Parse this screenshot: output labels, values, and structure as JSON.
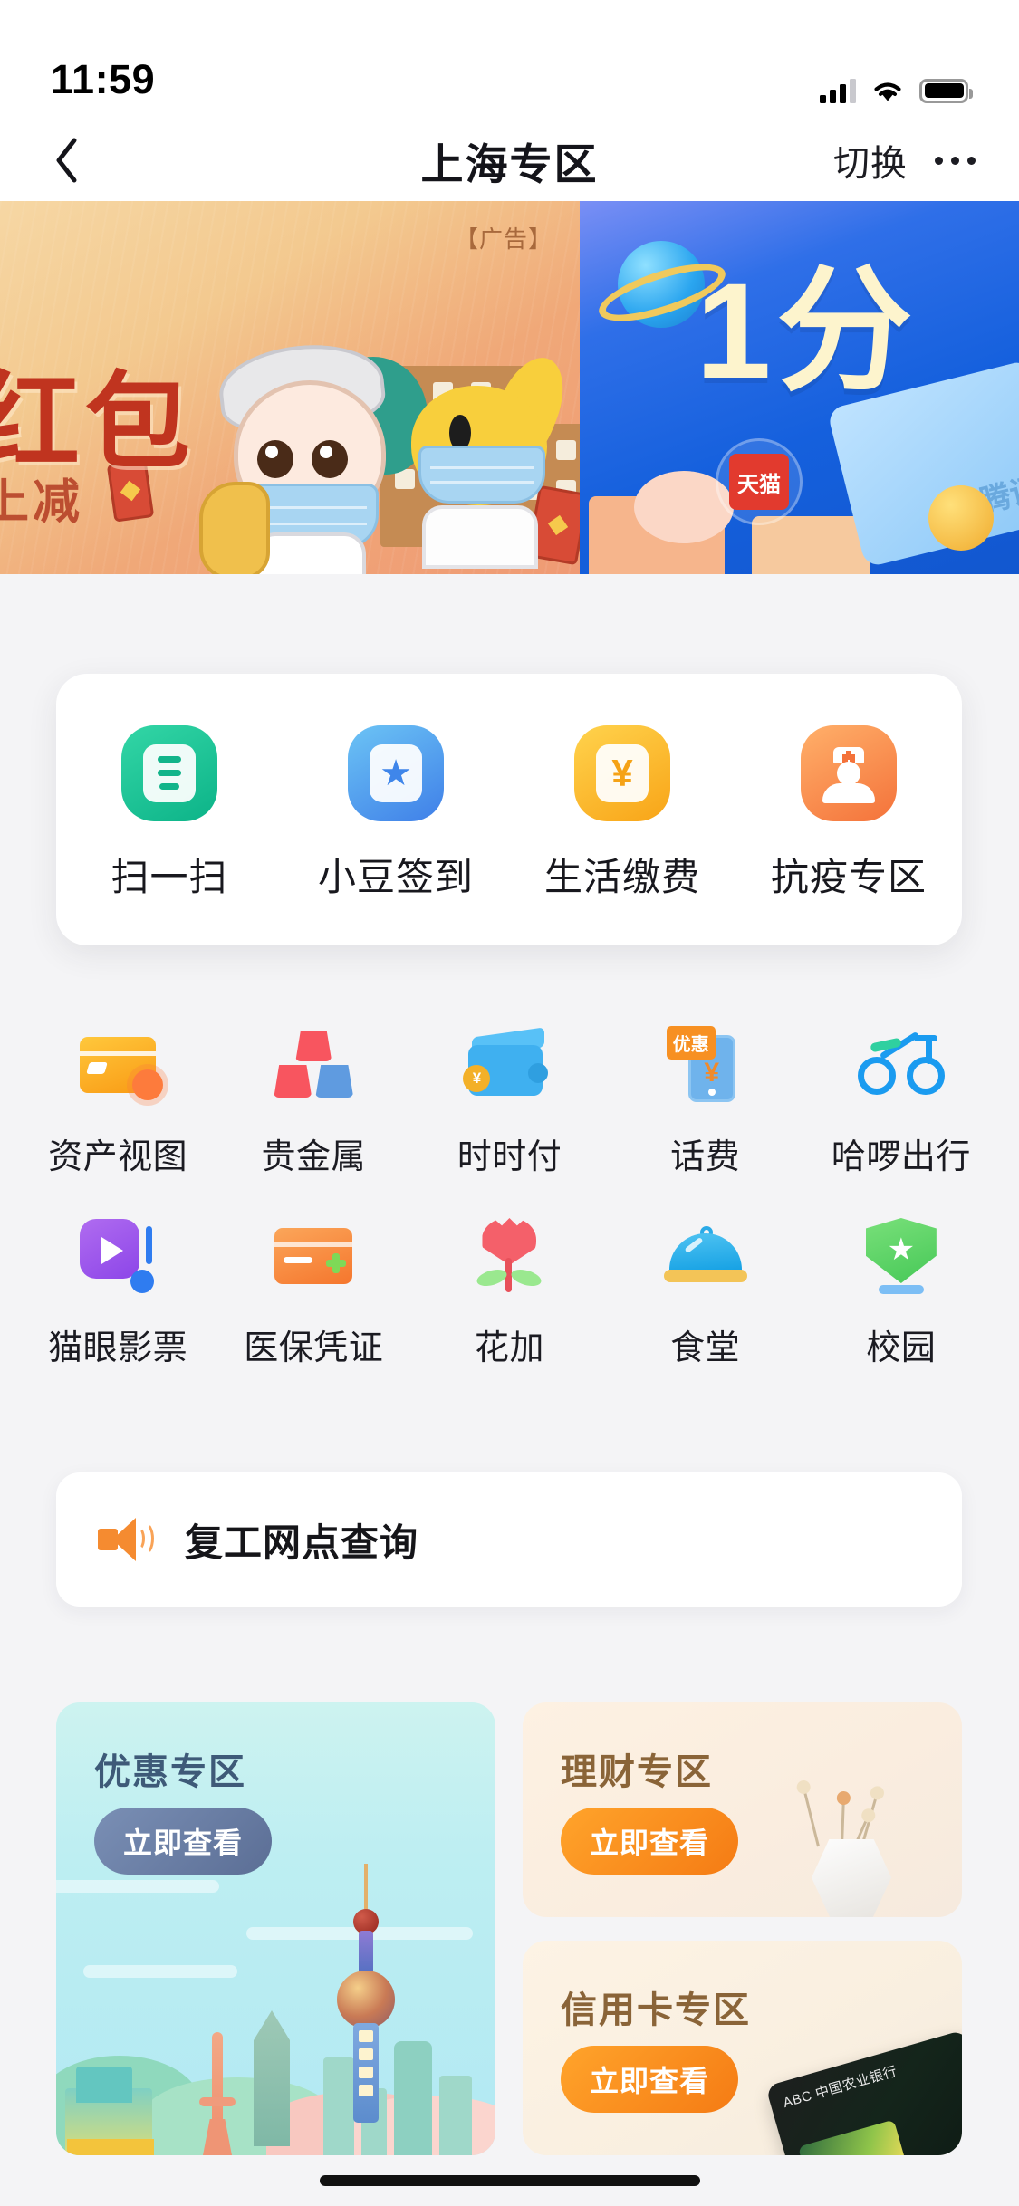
{
  "status_bar": {
    "time": "11:59",
    "signal_icon": "cellular-signal-icon",
    "wifi_icon": "wifi-icon",
    "battery_icon": "battery-icon"
  },
  "nav_bar": {
    "back_icon": "chevron-left-icon",
    "title": "上海专区",
    "switch_label": "切换",
    "more_icon": "more-dots-icon"
  },
  "banner": {
    "left": {
      "ad_tag": "【广告】",
      "headline": "红包",
      "subline": "上减",
      "mascot_icons": [
        "masked-mascot-icon",
        "masked-dog-mascot-icon"
      ]
    },
    "right": {
      "headline": "1分",
      "brand_badge": "天猫",
      "partner_label": "腾讯",
      "planet_icon": "planet-icon"
    }
  },
  "quick_actions": [
    {
      "label": "扫一扫",
      "icon": "scan-code-icon",
      "color": "#0cb388"
    },
    {
      "label": "小豆签到",
      "icon": "star-checkin-icon",
      "color": "#3f7fe8"
    },
    {
      "label": "生活缴费",
      "icon": "yen-payment-icon",
      "color": "#f8a417"
    },
    {
      "label": "抗疫专区",
      "icon": "nurse-epidemic-icon",
      "color": "#f4723a"
    }
  ],
  "icon_grid": {
    "row1": [
      {
        "label": "资产视图",
        "icon": "asset-card-icon"
      },
      {
        "label": "贵金属",
        "icon": "gold-bars-icon"
      },
      {
        "label": "时时付",
        "icon": "wallet-icon"
      },
      {
        "label": "话费",
        "icon": "mobile-topup-icon",
        "badge": "优惠"
      },
      {
        "label": "哈啰出行",
        "icon": "bicycle-icon"
      }
    ],
    "row2": [
      {
        "label": "猫眼影票",
        "icon": "movie-ticket-icon"
      },
      {
        "label": "医保凭证",
        "icon": "medical-insurance-card-icon"
      },
      {
        "label": "花加",
        "icon": "tulip-flower-icon"
      },
      {
        "label": "食堂",
        "icon": "food-cloche-icon"
      },
      {
        "label": "校园",
        "icon": "campus-shield-icon"
      }
    ]
  },
  "notice": {
    "icon": "megaphone-icon",
    "text": "复工网点查询"
  },
  "promos": [
    {
      "title": "优惠专区",
      "button": "立即查看",
      "theme": "cyan",
      "art": "shanghai-skyline-art"
    },
    {
      "title": "理财专区",
      "button": "立即查看",
      "theme": "cream",
      "art": "vase-flowers-art"
    },
    {
      "title": "信用卡专区",
      "button": "立即查看",
      "theme": "cream",
      "art": "credit-card-art"
    }
  ],
  "colors": {
    "page_bg": "#f4f4f6",
    "card_bg": "#ffffff",
    "accent_orange": "#f57b14",
    "accent_slate": "#5b6e95",
    "text_primary": "#18181e"
  }
}
